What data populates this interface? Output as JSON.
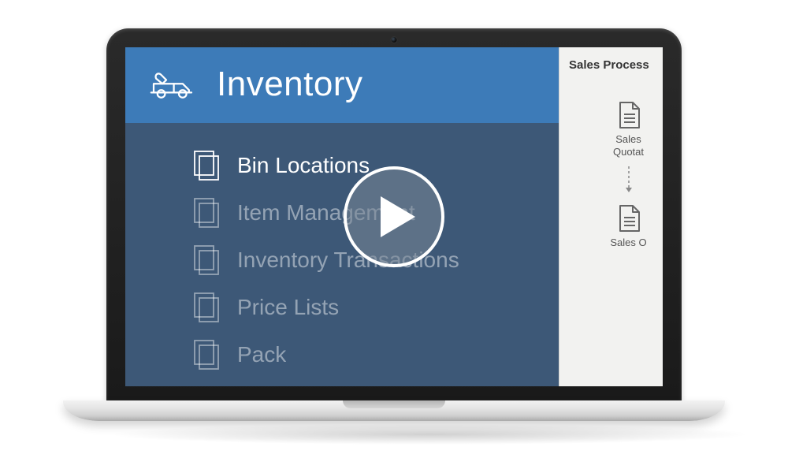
{
  "header": {
    "title": "Inventory"
  },
  "menu": {
    "items": [
      {
        "label": "Bin Locations",
        "active": true
      },
      {
        "label": "Item Management",
        "active": false
      },
      {
        "label": "Inventory Transactions",
        "active": false
      },
      {
        "label": "Price Lists",
        "active": false
      },
      {
        "label": "Pack",
        "active": false
      }
    ]
  },
  "side": {
    "title": "Sales Process",
    "items": [
      {
        "label_1": "Sales",
        "label_2": "Quotat"
      },
      {
        "label_1": "Sales O",
        "label_2": ""
      }
    ]
  }
}
